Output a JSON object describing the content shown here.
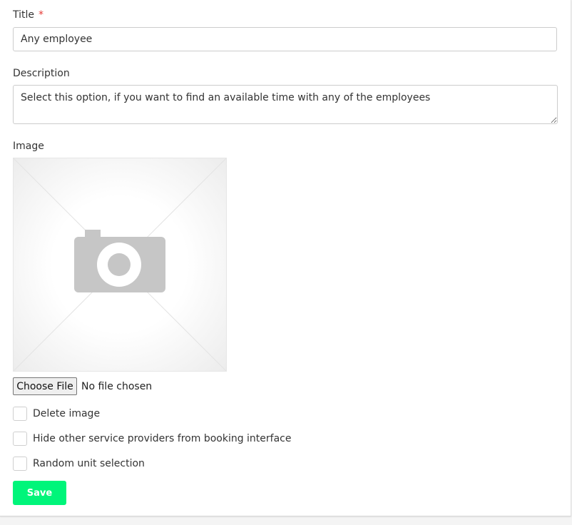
{
  "form": {
    "title_label": "Title",
    "required_marker": "*",
    "title_value": "Any employee",
    "description_label": "Description",
    "description_value": "Select this option, if you want to find an available time with any of the employees",
    "image_label": "Image",
    "image_placeholder_icon": "camera-icon",
    "file_button_label": "Choose File",
    "file_status": "No file chosen",
    "checkboxes": [
      {
        "label": "Delete image",
        "checked": false
      },
      {
        "label": "Hide other service providers from booking interface",
        "checked": false
      },
      {
        "label": "Random unit selection",
        "checked": false
      }
    ],
    "save_label": "Save"
  },
  "colors": {
    "accent": "#00f57a",
    "required": "#e53935",
    "placeholder_gray": "#c6c6c6"
  }
}
